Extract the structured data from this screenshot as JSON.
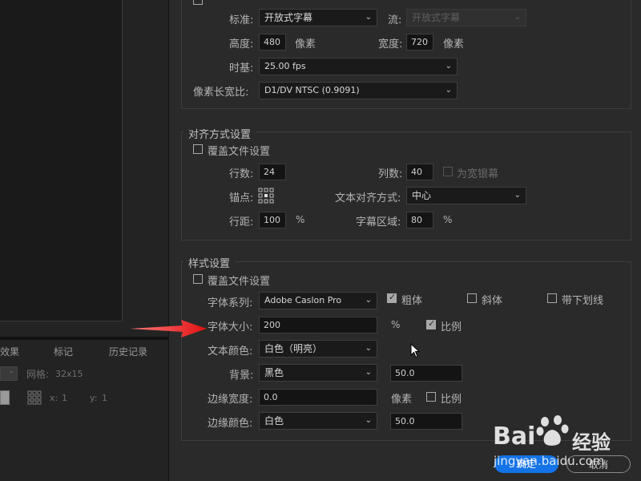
{
  "left": {
    "tabs": [
      "效果",
      "标记",
      "历史记录"
    ],
    "grid_label": "网格:",
    "grid_value": "32x15",
    "x_label": "x:",
    "x_value": "1",
    "y_label": "y:",
    "y_value": "1"
  },
  "video": {
    "standard_label": "标准:",
    "standard_value": "开放式字幕",
    "stream_label": "流:",
    "stream_value": "开放式字幕",
    "height_label": "高度:",
    "height_value": "480",
    "height_unit": "像素",
    "width_label": "宽度:",
    "width_value": "720",
    "width_unit": "像素",
    "timebase_label": "时基:",
    "timebase_value": "25.00 fps",
    "par_label": "像素长宽比:",
    "par_value": "D1/DV NTSC (0.9091)"
  },
  "alignment": {
    "title": "对齐方式设置",
    "override_label": "覆盖文件设置",
    "rows_label": "行数:",
    "rows_value": "24",
    "cols_label": "列数:",
    "cols_value": "40",
    "widescreen_label": "为宽银幕",
    "anchor_label": "锚点:",
    "text_align_label": "文本对齐方式:",
    "text_align_value": "中心",
    "line_spacing_label": "行距:",
    "line_spacing_value": "100",
    "line_spacing_unit": "%",
    "caption_area_label": "字幕区域:",
    "caption_area_value": "80",
    "caption_area_unit": "%"
  },
  "style": {
    "title": "样式设置",
    "override_label": "覆盖文件设置",
    "font_family_label": "字体系列:",
    "font_family_value": "Adobe Caslon Pro",
    "bold_label": "粗体",
    "italic_label": "斜体",
    "underline_label": "带下划线",
    "font_size_label": "字体大小:",
    "font_size_value": "200",
    "font_size_unit": "%",
    "proportional_label": "比例",
    "text_color_label": "文本颜色:",
    "text_color_value": "白色（明亮）",
    "background_label": "背景:",
    "background_value": "黑色",
    "background_opacity": "50.0",
    "edge_width_label": "边缘宽度:",
    "edge_width_value": "0.0",
    "edge_width_unit": "像素",
    "edge_proportional_label": "比例",
    "edge_color_label": "边缘颜色:",
    "edge_color_value": "白色",
    "edge_opacity": "50.0"
  },
  "buttons": {
    "ok_label": "确定",
    "cancel_label": "取消"
  },
  "watermark": {
    "brand": "Bai",
    "brand_suffix": "经验",
    "url": "jingyan.baidu.com"
  },
  "colors": {
    "accent": "#1473e6",
    "annotation_arrow": "#e02020"
  }
}
